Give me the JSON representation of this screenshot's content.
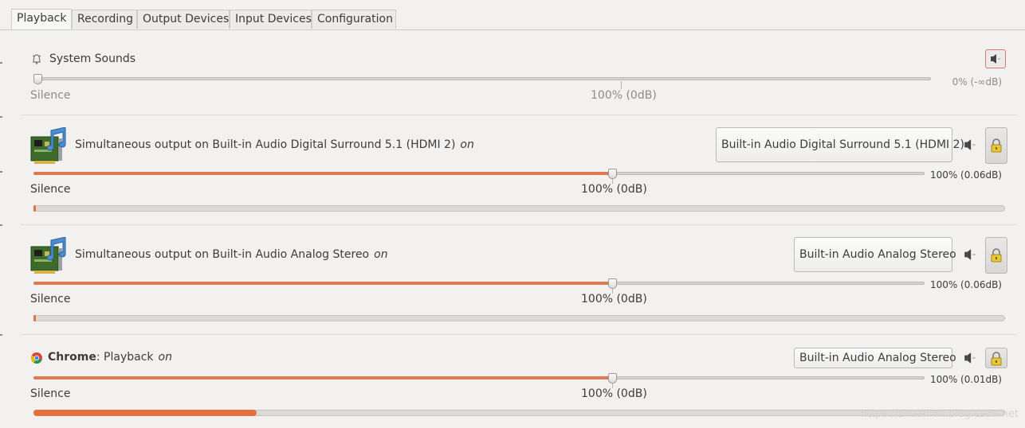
{
  "tabs": [
    "Playback",
    "Recording",
    "Output Devices",
    "Input Devices",
    "Configuration"
  ],
  "active_tab": "Playback",
  "system_sounds": {
    "title": "System Sounds",
    "silence_label": "Silence",
    "center_label": "100% (0dB)",
    "value": "0% (-∞dB)",
    "level_fraction": 0.0,
    "muted": true,
    "disabled": true
  },
  "streams": [
    {
      "title": "Simultaneous output on Built-in Audio Digital Surround 5.1 (HDMI 2)",
      "on_label": "on",
      "device": "Built-in Audio Digital Surround 5.1 (HDMI 2)",
      "silence_label": "Silence",
      "center_label": "100% (0dB)",
      "value": "100% (0.06dB)",
      "level_fraction": 0.65,
      "meter_fraction": 0.002
    },
    {
      "title": "Simultaneous output on Built-in Audio Analog Stereo",
      "on_label": "on",
      "device": "Built-in Audio Analog Stereo",
      "silence_label": "Silence",
      "center_label": "100% (0dB)",
      "value": "100% (0.06dB)",
      "level_fraction": 0.65,
      "meter_fraction": 0.002
    },
    {
      "app": "Chrome",
      "title": ": Playback",
      "on_label": "on",
      "device": "Built-in Audio Analog Stereo",
      "silence_label": "Silence",
      "center_label": "100% (0dB)",
      "value": "100% (0.01dB)",
      "level_fraction": 0.65,
      "meter_fraction": 0.23
    }
  ],
  "icons": {
    "system_sounds": "bell-icon",
    "stream_app": "sound-card-music-icon",
    "chrome": "chrome-icon",
    "mute": "speaker-icon",
    "lock": "padlock-icon"
  },
  "colors": {
    "slider_fill": "#d97a55",
    "meter_fill": "#e4713c",
    "background": "#f2f1f0"
  },
  "watermark": "https://zhuanlan.blog.csdn.net"
}
